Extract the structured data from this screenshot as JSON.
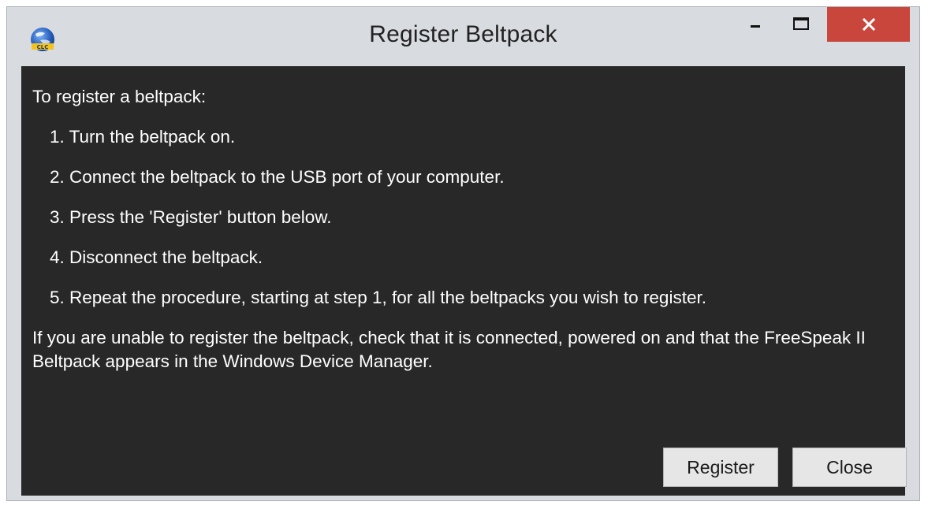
{
  "window": {
    "title": "Register Beltpack",
    "app_icon": "globe-app-icon",
    "controls": {
      "minimize_icon": "minimize-icon",
      "maximize_icon": "maximize-icon",
      "close_icon": "close-icon",
      "close_color": "#c9463d"
    }
  },
  "content": {
    "intro": "To register a beltpack:",
    "steps": [
      "1. Turn the beltpack on.",
      "2. Connect the beltpack to the USB port of your computer.",
      "3. Press the 'Register' button below.",
      "4. Disconnect the beltpack.",
      "5. Repeat the procedure, starting at step 1, for all the beltpacks you wish to register."
    ],
    "footer_note": "If you are unable to register the beltpack, check that it is connected, powered on and that the FreeSpeak II Beltpack appears in the Windows Device Manager.",
    "background_color": "#282828"
  },
  "buttons": {
    "register_label": "Register",
    "close_label": "Close"
  }
}
